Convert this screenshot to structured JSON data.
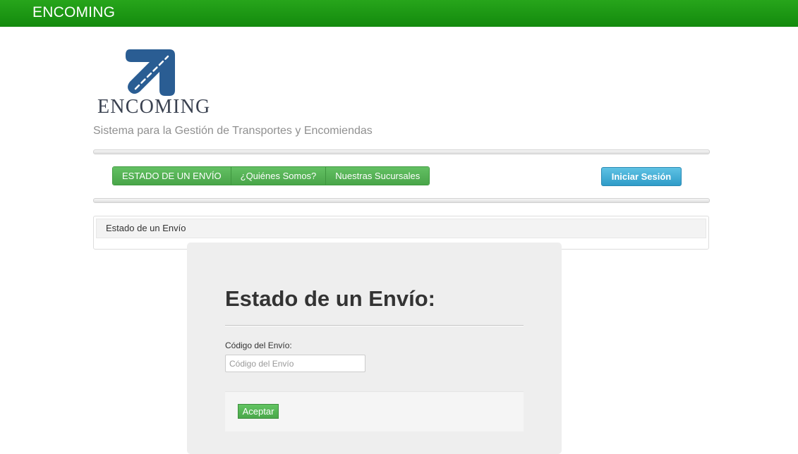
{
  "app": {
    "brand": "ENCOMING",
    "logo_text": "ENCOMING",
    "tagline": "Sistema para la Gestión de Transportes y Encomiendas"
  },
  "nav": {
    "items": [
      {
        "label": "ESTADO DE UN ENVÍO"
      },
      {
        "label": "¿Quiénes Somos?"
      },
      {
        "label": "Nuestras Sucursales"
      }
    ],
    "login_label": "Iniciar Sesión"
  },
  "panel": {
    "heading": "Estado de un Envío"
  },
  "form": {
    "title": "Estado de un Envío:",
    "code_label": "Código del Envío:",
    "code_value": "",
    "code_placeholder": "Código del Envío",
    "submit_label": "Aceptar"
  },
  "colors": {
    "topbar": "#1a961a",
    "nav_green": "#57b457",
    "login_blue": "#3aaad4",
    "logo_blue": "#2a5d93"
  },
  "icons": {
    "logo": "arrow-up-right-road-icon"
  }
}
